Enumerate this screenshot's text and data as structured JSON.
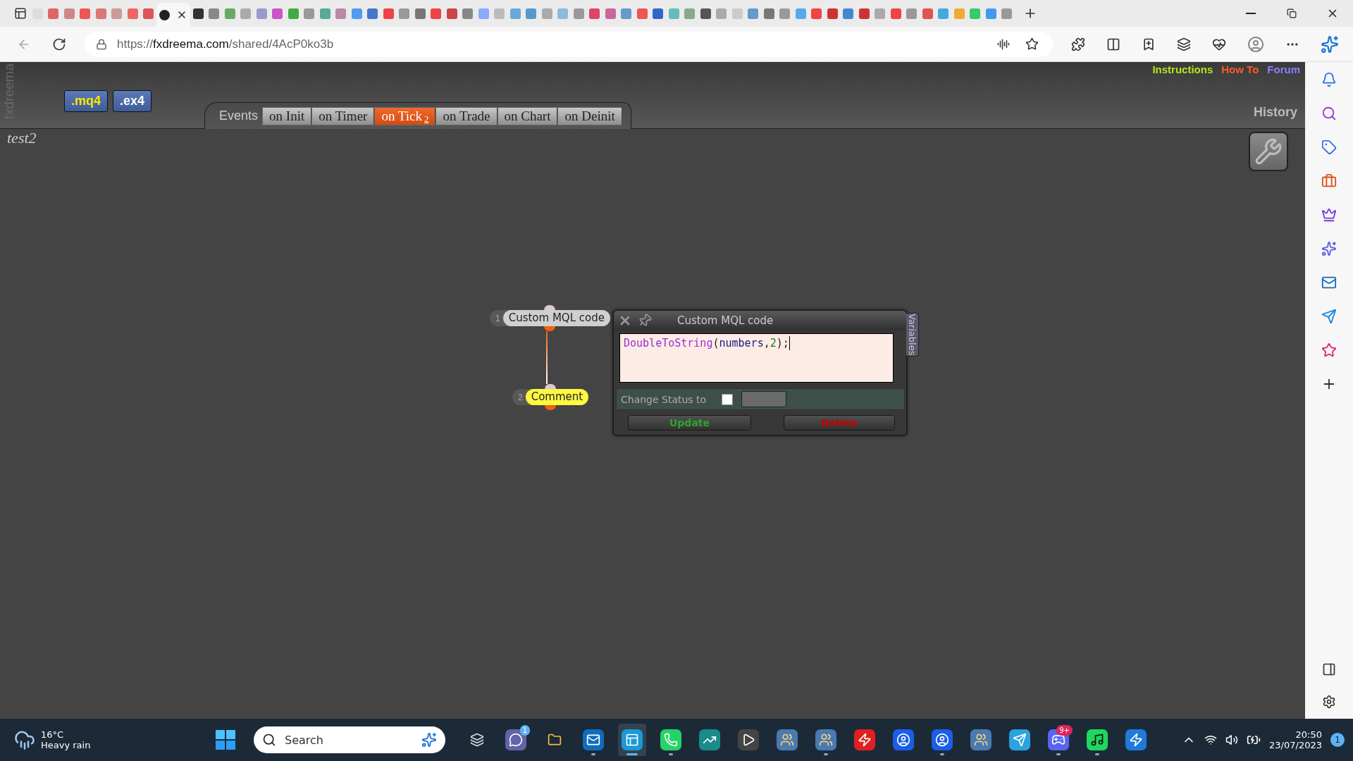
{
  "browser": {
    "url": {
      "scheme": "https://",
      "domain": "fxdreema.com",
      "path": "/shared/4AcP0ko3b"
    }
  },
  "app": {
    "brand": "fxdreema",
    "export_buttons": [
      ".mq4",
      ".ex4"
    ],
    "links": [
      {
        "label": "Instructions",
        "color": "#b5e61d"
      },
      {
        "label": "How To",
        "color": "#ff5a2a"
      },
      {
        "label": "Forum",
        "color": "#8a80ff"
      }
    ],
    "events_label": "Events",
    "event_tabs": [
      {
        "label": "on Init",
        "selected": false
      },
      {
        "label": "on Timer",
        "selected": false
      },
      {
        "label": "on Tick",
        "count": "2",
        "selected": true
      },
      {
        "label": "on Trade",
        "selected": false
      },
      {
        "label": "on Chart",
        "selected": false
      },
      {
        "label": "on Deinit",
        "selected": false
      }
    ],
    "history": "History",
    "project_title": "test2",
    "nodes": [
      {
        "number": "1",
        "label": "Custom MQL code",
        "kind": "code"
      },
      {
        "number": "2",
        "label": "Comment",
        "kind": "comment"
      }
    ],
    "dialog": {
      "title": "Custom MQL code",
      "code": [
        {
          "text": "DoubleToString",
          "kind": "function"
        },
        {
          "text": "(",
          "kind": "punct"
        },
        {
          "text": "numbers",
          "kind": "ident"
        },
        {
          "text": ",",
          "kind": "punct"
        },
        {
          "text": "2",
          "kind": "number"
        },
        {
          "text": ");",
          "kind": "punct"
        }
      ],
      "status_label": "Change Status to",
      "status_checked": false,
      "buttons": [
        {
          "label": "Update",
          "kind": "confirm"
        },
        {
          "label": "Delete",
          "kind": "danger"
        }
      ],
      "side_tab": "Variables"
    }
  },
  "taskbar": {
    "weather": {
      "temperature": "16°C",
      "condition": "Heavy rain"
    },
    "search_placeholder": "Search",
    "apps": [
      {
        "kind": "stack",
        "running": false
      },
      {
        "kind": "chat",
        "badge": "1",
        "running": false
      },
      {
        "kind": "folder",
        "running": false
      },
      {
        "kind": "mail",
        "running": true
      },
      {
        "kind": "browser",
        "running": true,
        "selected": true
      },
      {
        "kind": "phone",
        "running": true
      },
      {
        "kind": "chart",
        "running": false
      },
      {
        "kind": "player",
        "running": false
      },
      {
        "kind": "people",
        "running": false
      },
      {
        "kind": "people",
        "running": true
      },
      {
        "kind": "redsquare",
        "running": false
      },
      {
        "kind": "bluep",
        "running": false
      },
      {
        "kind": "bluep",
        "running": true
      },
      {
        "kind": "people",
        "running": false
      },
      {
        "kind": "plane",
        "running": false
      },
      {
        "kind": "game",
        "badge": "9+",
        "running": true
      },
      {
        "kind": "music",
        "running": true
      },
      {
        "kind": "zigzag",
        "running": false
      }
    ],
    "time": "20:50",
    "date": "23/07/2023",
    "notifications": "1"
  }
}
